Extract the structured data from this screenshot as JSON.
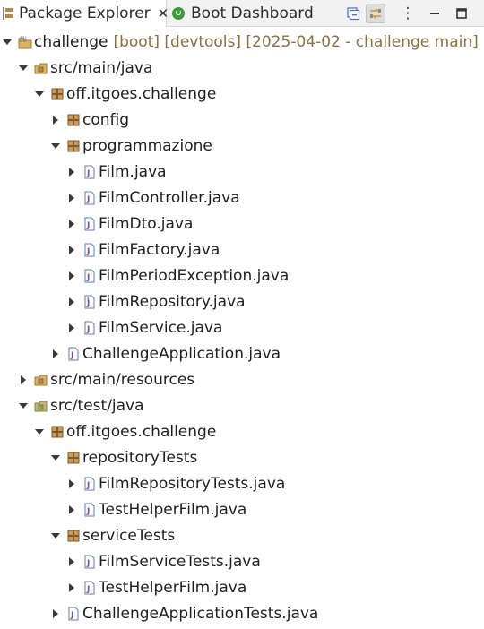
{
  "tabs": {
    "package_explorer": "Package Explorer",
    "close_glyph": "✕",
    "boot_dashboard": "Boot Dashboard"
  },
  "toolbar": {
    "menu_glyph": "⋮"
  },
  "tree": {
    "project": {
      "label": "challenge",
      "decoration": "[boot] [devtools] [2025-04-02 - challenge main]"
    },
    "src_main_java": "src/main/java",
    "pkg_main": "off.itgoes.challenge",
    "pkg_config": "config",
    "pkg_programmazione": "programmazione",
    "film_java": "Film.java",
    "film_controller": "FilmController.java",
    "film_dto": "FilmDto.java",
    "film_factory": "FilmFactory.java",
    "film_period_exception": "FilmPeriodException.java",
    "film_repository": "FilmRepository.java",
    "film_service": "FilmService.java",
    "challenge_application": "ChallengeApplication.java",
    "src_main_resources": "src/main/resources",
    "src_test_java": "src/test/java",
    "pkg_test": "off.itgoes.challenge",
    "pkg_repository_tests": "repositoryTests",
    "film_repository_tests": "FilmRepositoryTests.java",
    "test_helper_film_1": "TestHelperFilm.java",
    "pkg_service_tests": "serviceTests",
    "film_service_tests": "FilmServiceTests.java",
    "test_helper_film_2": "TestHelperFilm.java",
    "challenge_application_tests": "ChallengeApplicationTests.java"
  },
  "colors": {
    "decoration": "#8f6f3f",
    "package_icon": "#b5884f",
    "folder_icon": "#d7b46a",
    "java_file_icon": "#5a7fb0",
    "boot_icon": "#3e9b3a"
  }
}
